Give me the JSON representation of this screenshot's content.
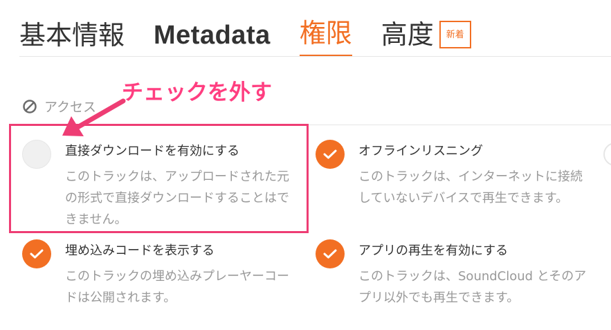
{
  "tabs": {
    "basic": "基本情報",
    "metadata": "Metadata",
    "permissions": "権限",
    "advanced": "高度",
    "new_badge": "新着"
  },
  "access": {
    "heading": "アクセス",
    "icon": "block-icon"
  },
  "options": [
    {
      "title": "直接ダウンロードを有効にする",
      "description": "このトラックは、アップロードされた元の形式で直接ダウンロードすることはできません。",
      "checked": false
    },
    {
      "title": "オフラインリスニング",
      "description": "このトラックは、インターネットに接続していないデバイスで再生できます。",
      "checked": true
    },
    {
      "title": "埋め込みコードを表示する",
      "description": "このトラックの埋め込みプレーヤーコードは公開されます。",
      "checked": true
    },
    {
      "title": "アプリの再生を有効にする",
      "description": "このトラックは、SoundCloud とそのアプリ以外でも再生できます。",
      "checked": true
    }
  ],
  "annotation": {
    "label": "チェックを外す"
  },
  "colors": {
    "accent": "#f26f23",
    "annotation": "#ee3d74",
    "muted_text": "#999999"
  }
}
